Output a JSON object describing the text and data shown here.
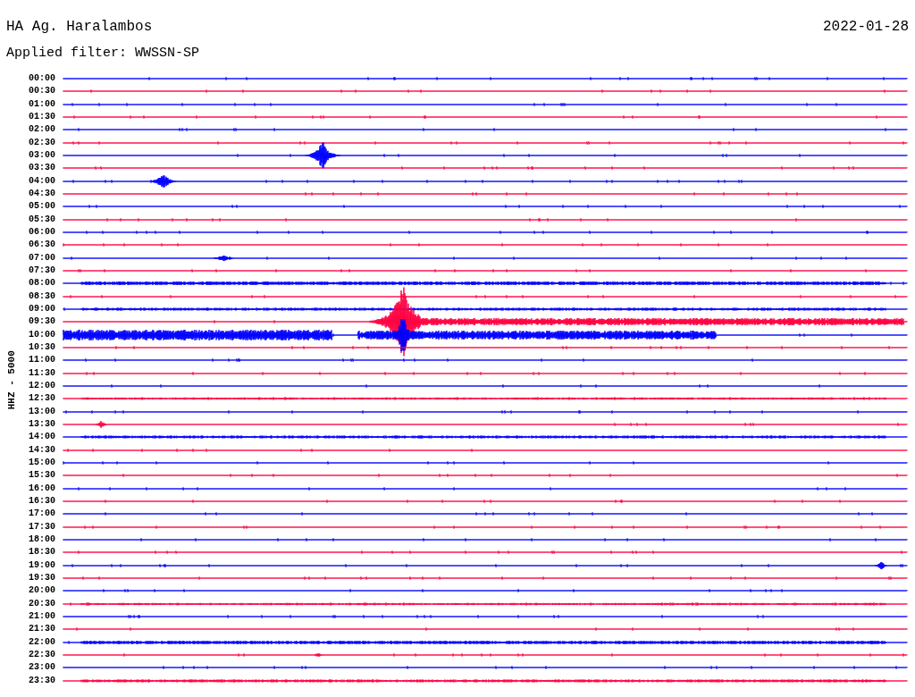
{
  "header": {
    "station": "HA Ag. Haralambos",
    "date": "2022-01-28",
    "filter": "Applied filter: WWSSN-SP"
  },
  "axis_label": "HHZ - 5000",
  "traces": [
    {
      "time": "00:00",
      "color": "#0000ff"
    },
    {
      "time": "00:30",
      "color": "#ff0040"
    },
    {
      "time": "01:00",
      "color": "#0000ff"
    },
    {
      "time": "01:30",
      "color": "#ff0040"
    },
    {
      "time": "02:00",
      "color": "#0000ff"
    },
    {
      "time": "02:30",
      "color": "#ff0040"
    },
    {
      "time": "03:00",
      "color": "#0000ff"
    },
    {
      "time": "03:30",
      "color": "#ff0040"
    },
    {
      "time": "04:00",
      "color": "#0000ff"
    },
    {
      "time": "04:30",
      "color": "#ff0040"
    },
    {
      "time": "05:00",
      "color": "#0000ff"
    },
    {
      "time": "05:30",
      "color": "#ff0040"
    },
    {
      "time": "06:00",
      "color": "#0000ff"
    },
    {
      "time": "06:30",
      "color": "#ff0040"
    },
    {
      "time": "07:00",
      "color": "#0000ff"
    },
    {
      "time": "07:30",
      "color": "#ff0040"
    },
    {
      "time": "08:00",
      "color": "#0000ff"
    },
    {
      "time": "08:30",
      "color": "#ff0040"
    },
    {
      "time": "09:00",
      "color": "#0000ff"
    },
    {
      "time": "09:30",
      "color": "#ff0040"
    },
    {
      "time": "10:00",
      "color": "#0000ff"
    },
    {
      "time": "10:30",
      "color": "#ff0040"
    },
    {
      "time": "11:00",
      "color": "#0000ff"
    },
    {
      "time": "11:30",
      "color": "#ff0040"
    },
    {
      "time": "12:00",
      "color": "#0000ff"
    },
    {
      "time": "12:30",
      "color": "#ff0040"
    },
    {
      "time": "13:00",
      "color": "#0000ff"
    },
    {
      "time": "13:30",
      "color": "#ff0040"
    },
    {
      "time": "14:00",
      "color": "#0000ff"
    },
    {
      "time": "14:30",
      "color": "#ff0040"
    },
    {
      "time": "15:00",
      "color": "#0000ff"
    },
    {
      "time": "15:30",
      "color": "#ff0040"
    },
    {
      "time": "16:00",
      "color": "#0000ff"
    },
    {
      "time": "16:30",
      "color": "#ff0040"
    },
    {
      "time": "17:00",
      "color": "#0000ff"
    },
    {
      "time": "17:30",
      "color": "#ff0040"
    },
    {
      "time": "18:00",
      "color": "#0000ff"
    },
    {
      "time": "18:30",
      "color": "#ff0040"
    },
    {
      "time": "19:00",
      "color": "#0000ff"
    },
    {
      "time": "19:30",
      "color": "#ff0040"
    },
    {
      "time": "20:00",
      "color": "#0000ff"
    },
    {
      "time": "20:30",
      "color": "#ff0040"
    },
    {
      "time": "21:00",
      "color": "#0000ff"
    },
    {
      "time": "21:30",
      "color": "#ff0040"
    },
    {
      "time": "22:00",
      "color": "#0000ff"
    },
    {
      "time": "22:30",
      "color": "#ff0040"
    },
    {
      "time": "23:00",
      "color": "#0000ff"
    },
    {
      "time": "23:30",
      "color": "#ff0040"
    }
  ]
}
